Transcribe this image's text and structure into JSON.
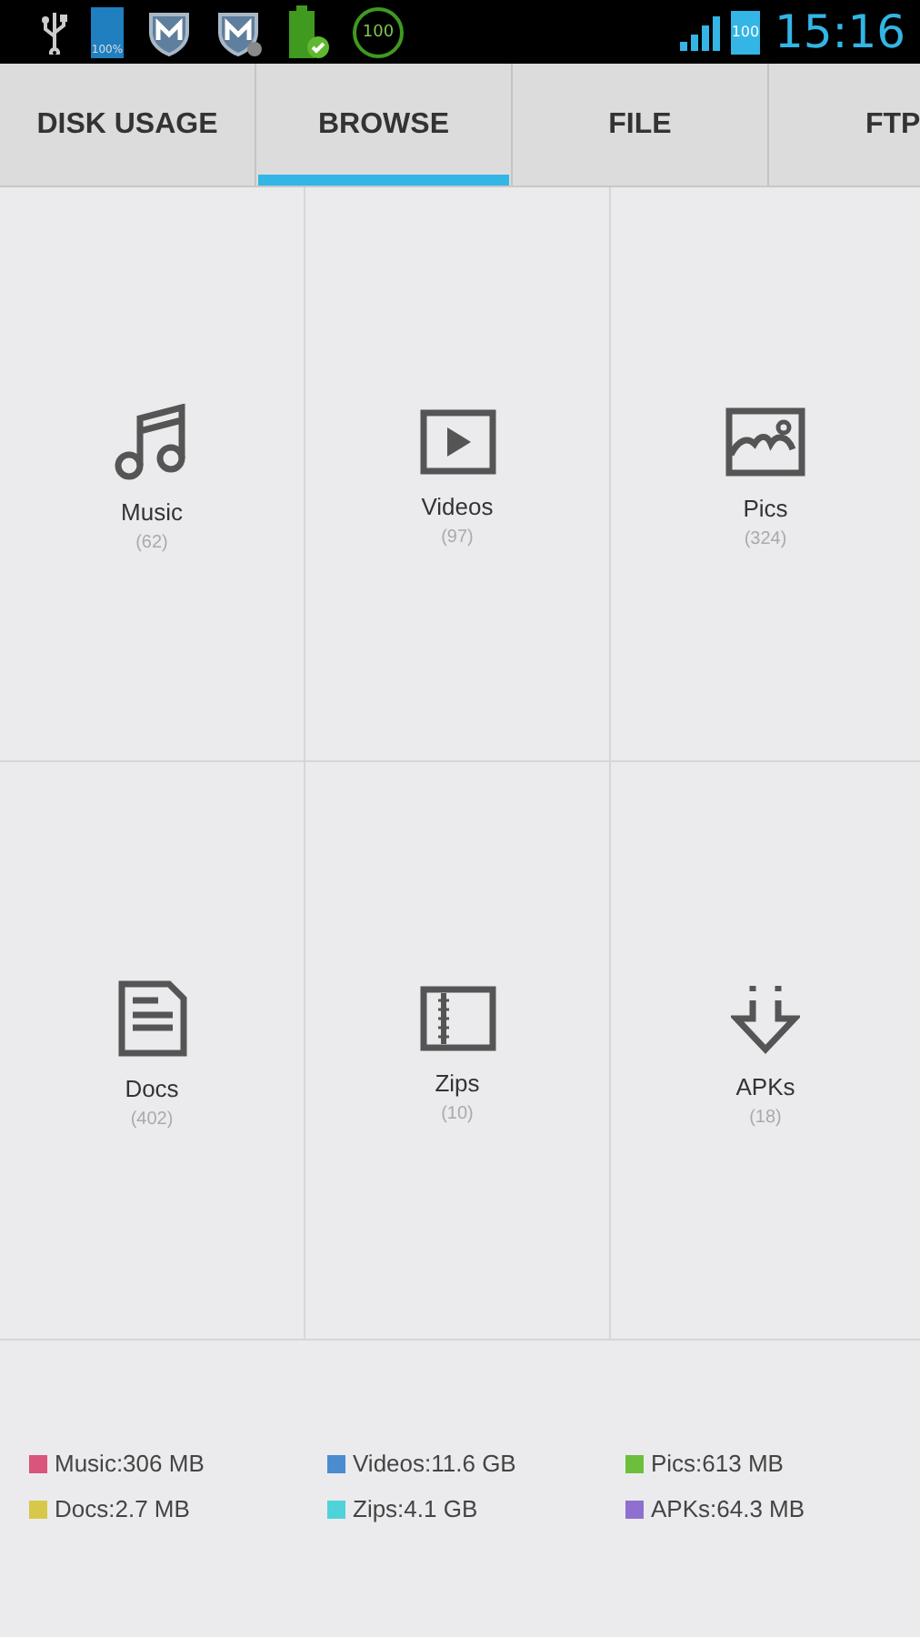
{
  "status_bar": {
    "left_icons": [
      {
        "kind": "usb"
      },
      {
        "kind": "battery",
        "text": "100%"
      },
      {
        "kind": "shield"
      },
      {
        "kind": "shield-badge"
      },
      {
        "kind": "battery-check"
      },
      {
        "kind": "ring",
        "text": "100"
      }
    ],
    "battery_text": "100",
    "time": "15:16"
  },
  "tabs": [
    {
      "label": "DISK USAGE",
      "selected": false
    },
    {
      "label": "BROWSE",
      "selected": true
    },
    {
      "label": "FILE",
      "selected": false
    },
    {
      "label": "FTP",
      "selected": false
    }
  ],
  "categories": [
    {
      "kind": "music",
      "label": "Music",
      "count": "(62)"
    },
    {
      "kind": "video",
      "label": "Videos",
      "count": "(97)"
    },
    {
      "kind": "picture",
      "label": "Pics",
      "count": "(324)"
    },
    {
      "kind": "document",
      "label": "Docs",
      "count": "(402)"
    },
    {
      "kind": "zip",
      "label": "Zips",
      "count": "(10)"
    },
    {
      "kind": "apk",
      "label": "APKs",
      "count": "(18)"
    }
  ],
  "legend": [
    {
      "text": "Music:306 MB",
      "color": "#d9557a"
    },
    {
      "text": "Videos:11.6 GB",
      "color": "#4a8ccf"
    },
    {
      "text": "Pics:613 MB",
      "color": "#6cbf3a"
    },
    {
      "text": "Docs:2.7 MB",
      "color": "#d8c84a"
    },
    {
      "text": "Zips:4.1 GB",
      "color": "#4fd3d8"
    },
    {
      "text": "APKs:64.3 MB",
      "color": "#8f6fcf"
    }
  ]
}
